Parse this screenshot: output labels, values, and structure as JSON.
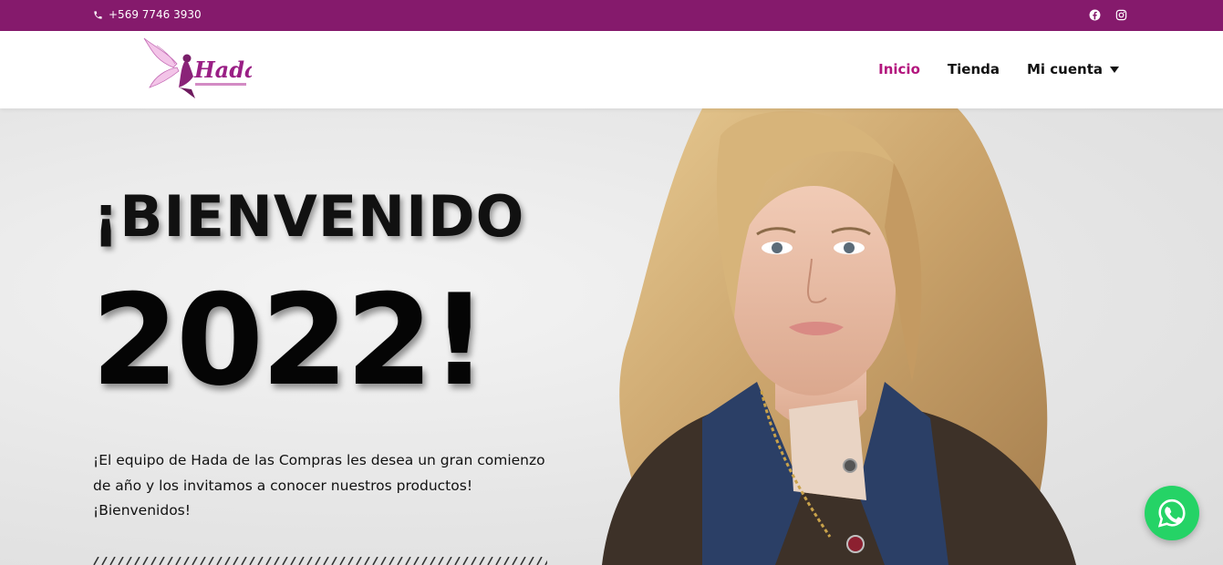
{
  "topbar": {
    "phone": "+569 7746 3930",
    "phone_icon": "phone-icon",
    "social": [
      "facebook-icon",
      "instagram-icon"
    ],
    "background": "#851a6c"
  },
  "header": {
    "logo_text": "Hada",
    "nav": {
      "inicio": "Inicio",
      "tienda": "Tienda",
      "mi_cuenta": "Mi cuenta"
    },
    "active_color": "#b3157d"
  },
  "hero": {
    "title_line1": "¡BIENVENIDO",
    "title_line2": "2022!",
    "description": "¡El equipo de Hada de las Compras les desea un gran comienzo de año y los invitamos a conocer nuestros productos! ¡Bienvenidos!"
  },
  "whatsapp": {
    "icon": "whatsapp-icon",
    "color": "#25d366"
  }
}
